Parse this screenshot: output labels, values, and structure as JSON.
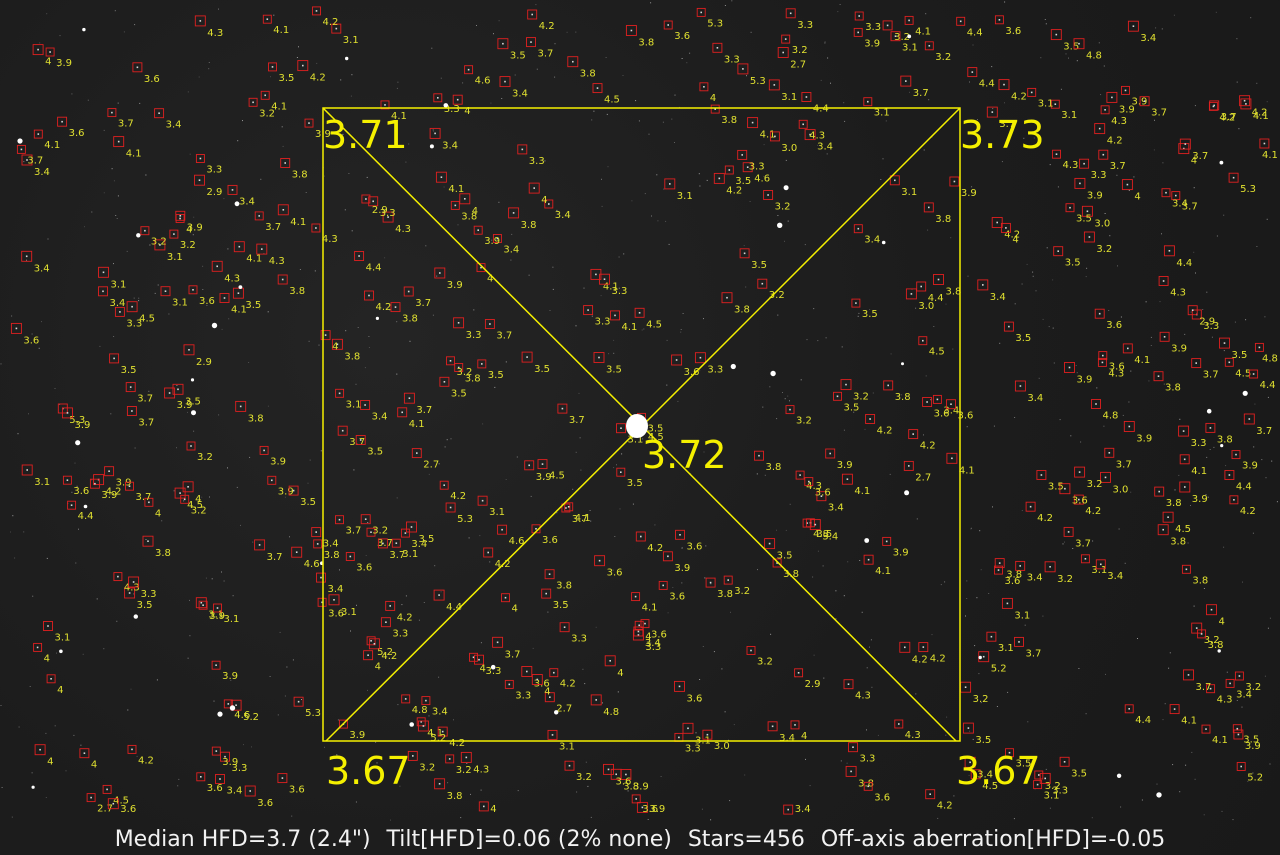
{
  "colors": {
    "background": "#1b1b1b",
    "overlay": "#f5f000",
    "star_box": "#e02020",
    "star_label": "#e0e030",
    "status_text": "#f2f2f2"
  },
  "tilt_overlay": {
    "top_left_hfd": "3.71",
    "top_right_hfd": "3.73",
    "bottom_left_hfd": "3.67",
    "bottom_right_hfd": "3.67",
    "center_hfd": "3.72"
  },
  "status": {
    "median_hfd": "Median HFD=3.7 (2.4\")",
    "tilt": "Tilt[HFD]=0.06 (2% none)",
    "stars": "Stars=456",
    "off_axis": "Off-axis aberration[HFD]=-0.05"
  },
  "hfd_labels": [
    "3.4",
    "3.5",
    "4.8",
    "3.7",
    "3.9",
    "4.1",
    "4.2",
    "4.5",
    "3.6",
    "3.8",
    "3.3",
    "4.3",
    "4",
    "3.2",
    "3.1",
    "4.4",
    "3.9",
    "3.5",
    "4.2",
    "5.3",
    "4",
    "3.7",
    "3.8",
    "3.6",
    "4.1",
    "3.3",
    "3.4",
    "3.2",
    "4.6",
    "3.1",
    "3.0",
    "3.5",
    "3.8",
    "4.2",
    "3.9",
    "4.1",
    "3.7",
    "3.6",
    "3.4",
    "4",
    "4.3",
    "3.5",
    "3.2",
    "3.3",
    "3.1",
    "2.7",
    "3.9",
    "4.4",
    "3.8",
    "4.1",
    "3.6",
    "3.7",
    "5.2",
    "3.4",
    "4.5",
    "3.2",
    "3.9",
    "3.3",
    "4.2",
    "4",
    "3.8",
    "3.5",
    "3.6",
    "4.1",
    "3.7",
    "3.1",
    "3.4",
    "2.9",
    "3.3",
    "3.2",
    "3.8",
    "4.3",
    "3.6",
    "3.9",
    "3.5",
    "4",
    "4.2",
    "3.7",
    "3.4",
    "3.1"
  ]
}
